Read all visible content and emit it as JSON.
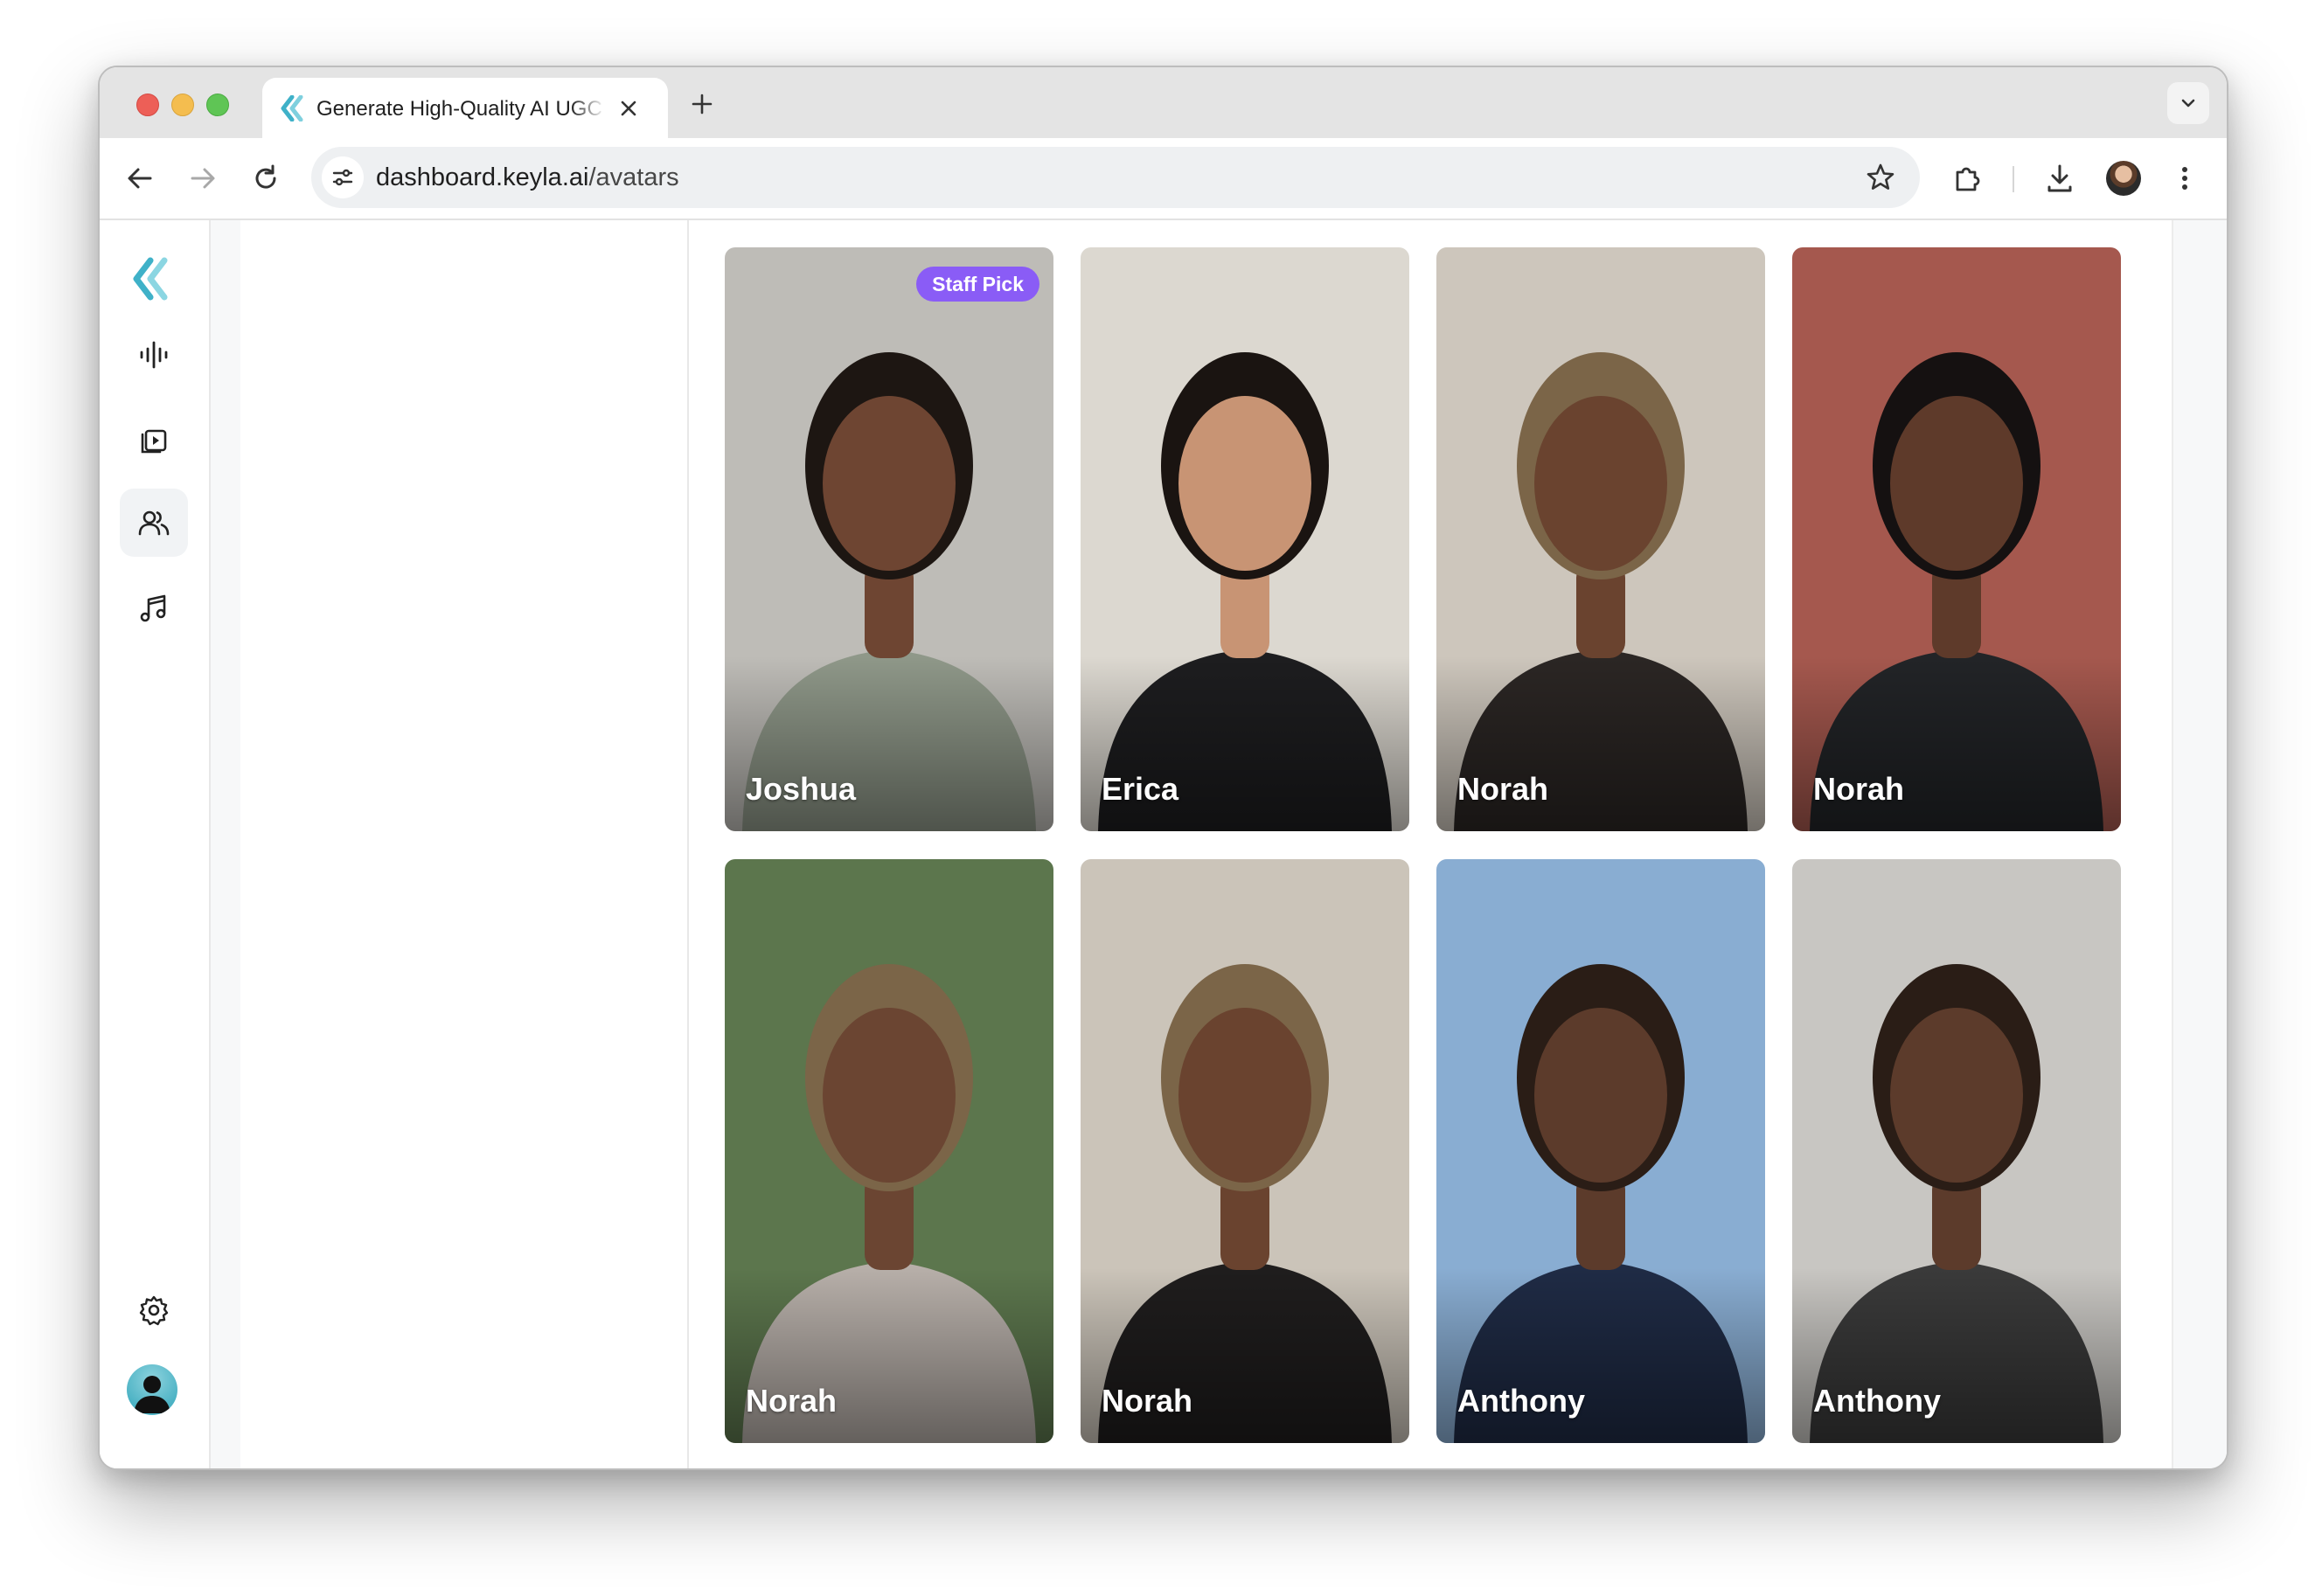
{
  "browser": {
    "tab_title": "Generate High-Quality AI UGC",
    "url_domain": "dashboard.keyla.ai",
    "url_path": "/avatars",
    "icons": [
      "close-icon",
      "plus-icon",
      "chevron-down-icon",
      "back-arrow-icon",
      "forward-arrow-icon",
      "reload-icon",
      "site-info-icon",
      "star-icon",
      "extensions-icon",
      "download-icon",
      "kebab-menu-icon"
    ]
  },
  "sidebar": {
    "logo": "keyla-logo",
    "items": [
      {
        "name": "voices",
        "icon": "waveform-icon",
        "active": false
      },
      {
        "name": "videos",
        "icon": "video-library-icon",
        "active": false
      },
      {
        "name": "avatars",
        "icon": "users-icon",
        "active": true
      },
      {
        "name": "music",
        "icon": "music-note-icon",
        "active": false
      }
    ],
    "bottom": {
      "settings_icon": "gear-icon",
      "avatar_icon": "user-avatar"
    }
  },
  "avatars": [
    {
      "name": "Joshua",
      "badge": "Staff Pick",
      "bg": "#b9b7b1",
      "skin": "#6e4532",
      "shirt": "#8f9889",
      "hair": "#1d1612"
    },
    {
      "name": "Erica",
      "bg": "#d9d5cc",
      "skin": "#c89474",
      "shirt": "#1d1d1f",
      "hair": "#1a1411"
    },
    {
      "name": "Norah",
      "bg": "#c9c2b7",
      "skin": "#6a432f",
      "shirt": "#2b2624",
      "hair": "#7b6548"
    },
    {
      "name": "Norah",
      "bg": "#9e4a3f",
      "skin": "#5e3a2a",
      "shirt": "#222427",
      "hair": "#151111"
    },
    {
      "name": "Norah",
      "bg": "#4f6b3e",
      "skin": "#6b4532",
      "shirt": "#b7afa9",
      "hair": "#7b6548"
    },
    {
      "name": "Norah",
      "bg": "#c7bfb3",
      "skin": "#6a432f",
      "shirt": "#1f1d1d",
      "hair": "#7b6548"
    },
    {
      "name": "Anthony",
      "bg": "#7fa6cf",
      "skin": "#5c3b2b",
      "shirt": "#1f2b45",
      "hair": "#2a1d16"
    },
    {
      "name": "Anthony",
      "bg": "#c4c2bd",
      "skin": "#5c3b2b",
      "shirt": "#3a3a3a",
      "hair": "#2a1d16"
    }
  ],
  "chat": {
    "icon": "chat-bubble-icon"
  },
  "colors": {
    "accent": "#8a5cf6",
    "logo": "#3fb1c8"
  }
}
